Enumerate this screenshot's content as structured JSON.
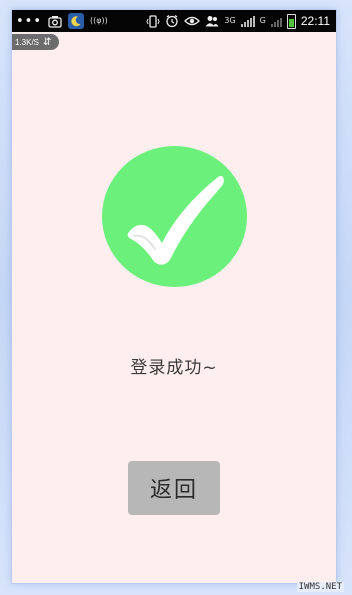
{
  "status_bar": {
    "time": "22:11",
    "hotspot_label": "((φ))",
    "network_type": "3G",
    "signal_subscript": "G"
  },
  "net_speed": {
    "value": "1.3K/S",
    "arrows": "⇵"
  },
  "main": {
    "message": "登录成功~",
    "back_button_label": "返回"
  },
  "colors": {
    "background": "#feeeed",
    "success_circle": "#6af07b",
    "button": "#b7b7b7"
  },
  "icons": {
    "success": "check-mark-icon"
  },
  "watermark": "IWMS.NET"
}
